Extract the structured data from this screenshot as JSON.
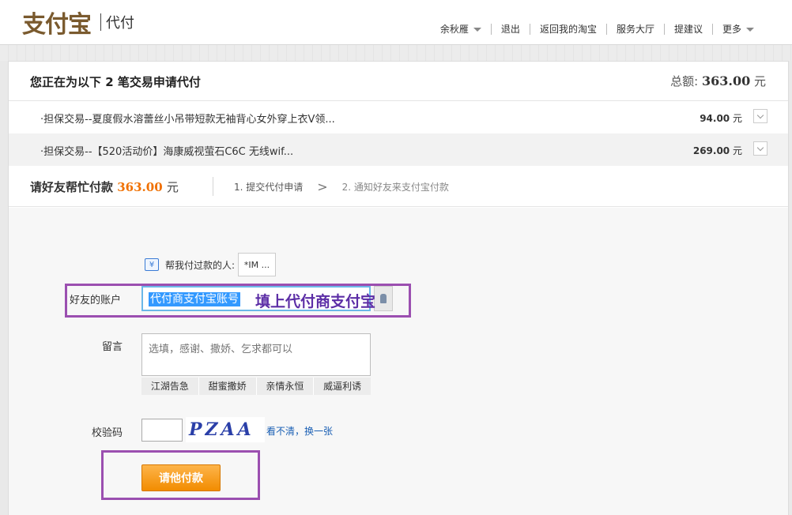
{
  "brand": {
    "logo": "支付宝",
    "product": "代付"
  },
  "topnav": [
    "余秋雁",
    "退出",
    "返回我的淘宝",
    "服务大厅",
    "提建议",
    "更多"
  ],
  "summary": {
    "title": "您正在为以下 2 笔交易申请代付",
    "total_label": "总额:",
    "total_value": "363.00",
    "unit": "元"
  },
  "trades": [
    {
      "name": "·担保交易--夏度假水溶蕾丝小吊带短款无袖背心女外穿上衣V领...",
      "amount": "94.00",
      "unit": "元"
    },
    {
      "name": "·担保交易--【520活动价】海康威视萤石C6C 无线wif...",
      "amount": "269.00",
      "unit": "元"
    }
  ],
  "payment": {
    "label": "请好友帮忙付款",
    "amount": "363.00",
    "unit": "元",
    "step1": "1. 提交代付申请",
    "step_arrow": ">",
    "step2": "2. 通知好友来支付宝付款"
  },
  "form": {
    "helper_label": "帮我付过款的人:",
    "helper_value": "*IM ...",
    "account_label": "好友的账户",
    "account_value": "代付商支付宝账号",
    "annotation": "填上代付商支付宝",
    "message_label": "留言",
    "message_placeholder": "选填，感谢、撒娇、乞求都可以",
    "quick_phrases": [
      "江湖告急",
      "甜蜜撒娇",
      "亲情永恒",
      "威逼利诱"
    ],
    "captcha_label": "校验码",
    "captcha_text": "PZAA",
    "refresh_link": "看不清，换一张",
    "submit_label": "请他付款"
  },
  "colors": {
    "accent": "#f07000",
    "highlight": "#9b4fb0",
    "link": "#1a5fb4"
  }
}
